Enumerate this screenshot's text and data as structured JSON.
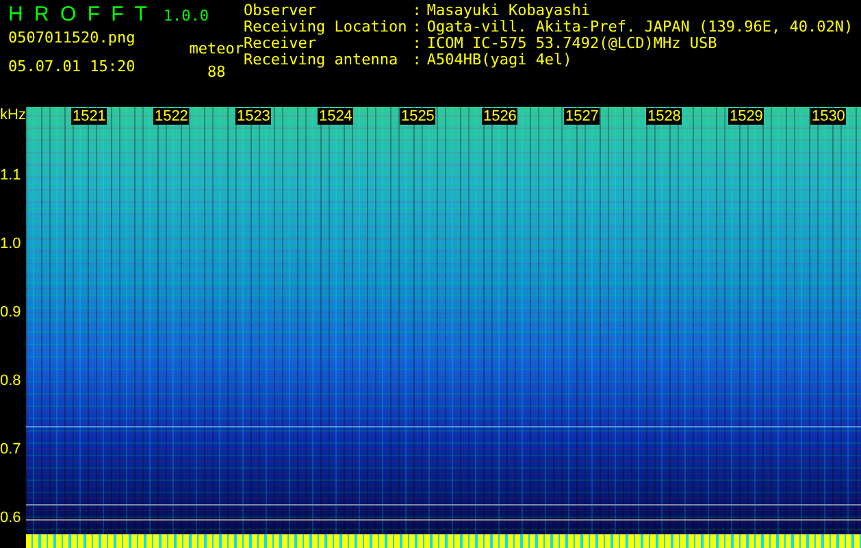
{
  "app": {
    "title": "H R O F F T",
    "version": "1.0.0"
  },
  "file": {
    "name": "0507011520.png",
    "datetime": "05.07.01 15:20"
  },
  "meteor": {
    "label": "meteor",
    "count": "88"
  },
  "info": [
    {
      "label": "Observer",
      "separator": ":",
      "value": "Masayuki Kobayashi"
    },
    {
      "label": "Receiving Location",
      "separator": ":",
      "value": "Ogata-vill. Akita-Pref. JAPAN (139.96E, 40.02N)"
    },
    {
      "label": "Receiver",
      "separator": ":",
      "value": "ICOM IC-575 53.7492(@LCD)MHz USB"
    },
    {
      "label": "Receiving antenna",
      "separator": ":",
      "value": "A504HB(yagi 4el)"
    }
  ],
  "spectrogram": {
    "unit": "kHz",
    "time_labels": [
      "1521",
      "1522",
      "1523",
      "1524",
      "1525",
      "1526",
      "1527",
      "1528",
      "1529",
      "1530"
    ],
    "freq_labels": [
      "1.1",
      "1.0",
      "0.9",
      "0.8",
      "0.7",
      "0.6"
    ]
  }
}
